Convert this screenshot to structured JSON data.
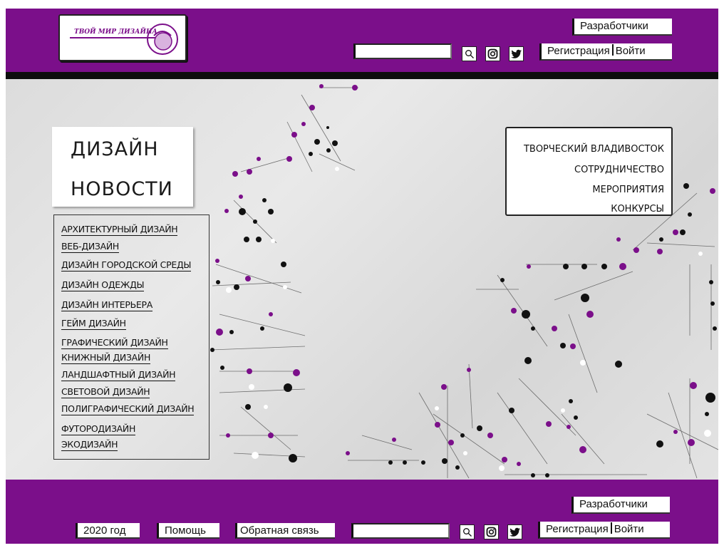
{
  "header": {
    "logo_text": "ТВОЙ МИР ДИЗАЙНА",
    "developers_label": "Разработчики",
    "search_placeholder": "",
    "register_label": "Регистрация",
    "login_label": "Войти"
  },
  "main": {
    "news_title_line1": "ДИЗАЙН",
    "news_title_line2": "НОВОСТИ",
    "categories": [
      "АРХИТЕКТУРНЫЙ ДИЗАЙН",
      "ВЕБ-ДИЗАЙН",
      "ДИЗАЙН ГОРОДСКОЙ СРЕДЫ",
      "ДИЗАЙН ОДЕЖДЫ",
      "ДИЗАЙН ИНТЕРЬЕРА",
      "ГЕЙМ ДИЗАЙН",
      "ГРАФИЧЕСКИЙ ДИЗАЙН",
      "КНИЖНЫЙ ДИЗАЙН",
      "ЛАНДШАФТНЫЙ ДИЗАЙН",
      "СВЕТОВОЙ ДИЗАЙН",
      "ПОЛИГРАФИЧЕСКИЙ ДИЗАЙН",
      "ФУТОРОДИЗАЙН",
      "ЭКОДИЗАЙН"
    ],
    "menu": [
      "ТВОРЧЕСКИЙ ВЛАДИВОСТОК",
      "СОТРУДНИЧЕСТВО",
      "МЕРОПРИЯТИЯ",
      "КОНКУРСЫ"
    ]
  },
  "footer": {
    "developers_label": "Разработчики",
    "year_label": "2020 год",
    "help_label": "Помощь",
    "feedback_label": "Обратная связь",
    "register_label": "Регистрация",
    "login_label": "Войти"
  },
  "icons": [
    "search-icon",
    "instagram-icon",
    "twitter-icon"
  ],
  "colors": {
    "brand": "#7b0f8a",
    "dark": "#111111",
    "bg": "#e2e2e2"
  }
}
